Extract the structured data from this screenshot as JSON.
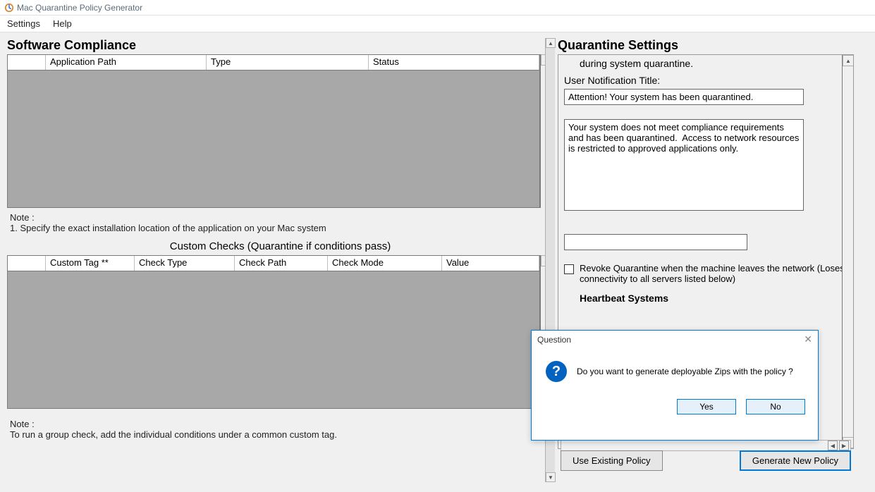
{
  "window": {
    "title": "Mac Quarantine Policy Generator"
  },
  "menu": {
    "settings": "Settings",
    "help": "Help"
  },
  "left": {
    "softwareComplianceTitle": "Software Compliance",
    "cols": {
      "blank": "",
      "appPath": "Application Path",
      "type": "Type",
      "status": "Status"
    },
    "noteLabel": "Note :",
    "note1": "1. Specify the exact installation location of the application on your Mac system",
    "customChecksTitle": "Custom Checks (Quarantine if conditions pass)",
    "cols2": {
      "blank": "",
      "customTag": "Custom Tag **",
      "checkType": "Check Type",
      "checkPath": "Check Path",
      "checkMode": "Check Mode",
      "value": "Value"
    },
    "note2Label": "Note :",
    "note2": "To run a group check, add the individual conditions under a common custom tag."
  },
  "right": {
    "title": "Quarantine Settings",
    "partial": "during system quarantine.",
    "notifTitleLabel": "User Notification Title:",
    "notifTitle": "Attention! Your system has been quarantined.",
    "notifBody": "Your system does not meet compliance requirements and has been quarantined.  Access to network resources is restricted to approved applications only.",
    "extraField": "",
    "revokeLabel": "Revoke Quarantine when the machine leaves the network (Loses connectivity to all servers listed below)",
    "heartbeat": "Heartbeat Systems",
    "useExisting": "Use Existing Policy",
    "generateNew": "Generate New Policy"
  },
  "dialog": {
    "title": "Question",
    "message": "Do you want to generate deployable Zips with the policy ?",
    "yes": "Yes",
    "no": "No"
  }
}
